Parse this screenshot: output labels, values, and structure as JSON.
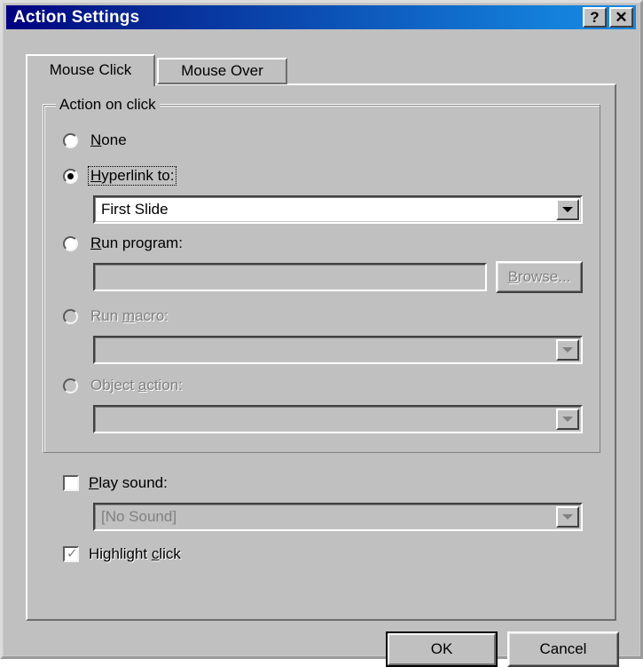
{
  "window": {
    "title": "Action Settings",
    "help_button": "?",
    "close_button": "✕",
    "titlebar_color_left": "#000080",
    "titlebar_color_right": "#1787e2",
    "face_color": "#c0c0c0"
  },
  "tabs": [
    {
      "label": "Mouse Click",
      "selected": true
    },
    {
      "label": "Mouse Over",
      "selected": false
    }
  ],
  "group": {
    "label": "Action on click",
    "options": [
      {
        "id": "none",
        "label_before": "",
        "accel": "N",
        "label_after": "one",
        "checked": false,
        "disabled": false,
        "focused": false
      },
      {
        "id": "hyperlink-to",
        "label_before": "",
        "accel": "H",
        "label_after": "yperlink to:",
        "checked": true,
        "disabled": false,
        "focused": true
      },
      {
        "id": "run-program",
        "label_before": "",
        "accel": "R",
        "label_after": "un program:",
        "checked": false,
        "disabled": false,
        "focused": false
      },
      {
        "id": "run-macro",
        "label_before": "Run ",
        "accel": "m",
        "label_after": "acro:",
        "checked": false,
        "disabled": true,
        "focused": false
      },
      {
        "id": "object-action",
        "label_before": "Object ",
        "accel": "a",
        "label_after": "ction:",
        "checked": false,
        "disabled": true,
        "focused": false
      }
    ],
    "hyperlink_combo": {
      "value": "First Slide",
      "disabled": false,
      "options": [
        "First Slide"
      ]
    },
    "program_field": {
      "value": "",
      "placeholder": "",
      "disabled": true
    },
    "browse_button": {
      "label_before": "B",
      "accel": "B",
      "label": "Browse...",
      "label_after": "rowse...",
      "disabled": true
    },
    "macro_combo": {
      "value": "",
      "disabled": true,
      "options": []
    },
    "object_combo": {
      "value": "",
      "disabled": true,
      "options": []
    }
  },
  "play_sound": {
    "label_before": "",
    "accel": "P",
    "label_after": "lay sound:",
    "checked": false,
    "disabled": false,
    "combo": {
      "value": "[No Sound]",
      "disabled": true,
      "options": [
        "[No Sound]"
      ]
    }
  },
  "highlight_click": {
    "label_before": "Highlight ",
    "accel": "c",
    "label_after": "lick",
    "checked": true,
    "disabled": true
  },
  "footer": {
    "ok_label": "OK",
    "cancel_label": "Cancel"
  }
}
